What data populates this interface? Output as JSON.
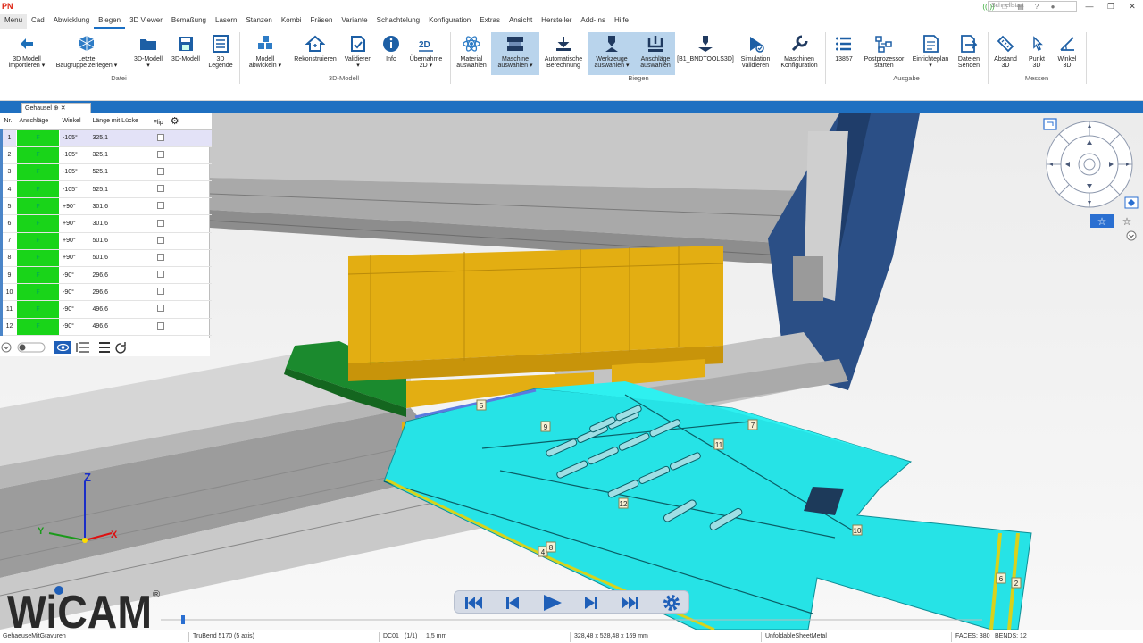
{
  "app": {
    "logo_text": "PN"
  },
  "tabs": [
    "Menu",
    "Cad",
    "Abwicklung",
    "Biegen",
    "3D Viewer",
    "Bemaßung",
    "Lasern",
    "Stanzen",
    "Kombi",
    "Fräsen",
    "Variante",
    "Schachtelung",
    "Konfiguration",
    "Extras",
    "Ansicht",
    "Hersteller",
    "Add-Ins",
    "Hilfe"
  ],
  "active_tab": "Biegen",
  "search": {
    "placeholder": "Schnellstart"
  },
  "ribbon": {
    "groups": {
      "datei": "Datei",
      "modell": "3D-Modell",
      "biegen": "Biegen",
      "ausgabe": "Ausgabe",
      "messen": "Messen"
    },
    "buttons": {
      "import3d": "3D Modell\nimportieren ▾",
      "letzte": "Letzte\nBaugruppe zerlegen ▾",
      "modell3d_a": "3D-Modell\n▾",
      "modell3d_b": "3D-Modell",
      "legende": "3D\nLegende",
      "abwickeln": "Modell\nabwickeln ▾",
      "rekon": "Rekonstruieren",
      "validieren": "Validieren\n▾",
      "info": "Info",
      "uebernahme": "Übernahme\n2D ▾",
      "material": "Material\nauswählen",
      "maschine": "Maschine\nauswählen ▾",
      "autoberech": "Automatische\nBerechnung",
      "werkzeuge": "Werkzeuge\nauswählen ▾",
      "anschlaege": "Anschläge\nauswählen",
      "tools": "[B1_BNDTOOLS3D]",
      "simulation": "Simulation\nvalidieren",
      "konfig": "Maschinen\nKonfiguration",
      "nr": "13857",
      "postproc": "Postprozessor\nstarten",
      "einricht": "Einrichteplan\n▾",
      "dateien": "Dateien\nSenden",
      "abstand": "Abstand\n3D",
      "punkt": "Punkt\n3D",
      "winkel": "Winkel\n3D"
    }
  },
  "document": {
    "tab_label": "Gehausel ⊕ ✕"
  },
  "bend_table": {
    "headers": [
      "Nr.",
      "Anschläge",
      "Winkel",
      "Länge mit Lücke",
      "Flip"
    ],
    "rows": [
      {
        "nr": "1",
        "stop": "F",
        "angle": "-105°",
        "length": "325,1"
      },
      {
        "nr": "2",
        "stop": "F",
        "angle": "-105°",
        "length": "325,1"
      },
      {
        "nr": "3",
        "stop": "F",
        "angle": "-105°",
        "length": "525,1"
      },
      {
        "nr": "4",
        "stop": "F",
        "angle": "-105°",
        "length": "525,1"
      },
      {
        "nr": "5",
        "stop": "F",
        "angle": "+90°",
        "length": "301,6"
      },
      {
        "nr": "6",
        "stop": "F",
        "angle": "+90°",
        "length": "301,6"
      },
      {
        "nr": "7",
        "stop": "F",
        "angle": "+90°",
        "length": "501,6"
      },
      {
        "nr": "8",
        "stop": "F",
        "angle": "+90°",
        "length": "501,6"
      },
      {
        "nr": "9",
        "stop": "F",
        "angle": "-90°",
        "length": "296,6"
      },
      {
        "nr": "10",
        "stop": "F",
        "angle": "-90°",
        "length": "296,6"
      },
      {
        "nr": "11",
        "stop": "F",
        "angle": "-90°",
        "length": "496,6"
      },
      {
        "nr": "12",
        "stop": "F",
        "angle": "-90°",
        "length": "496,6"
      }
    ],
    "selected_row": "1"
  },
  "scene": {
    "bend_labels": [
      "5",
      "9",
      "7",
      "11",
      "12",
      "10",
      "4",
      "8",
      "6",
      "2"
    ],
    "axes": {
      "x": "X",
      "y": "Y",
      "z": "Z"
    },
    "colors": {
      "sheet": "#26e3e6",
      "upper_tool": "#e3ae12",
      "die_holder": "#1b8a2e",
      "frame": "#2b4f86",
      "bendline": "#d8d21c"
    }
  },
  "logo": {
    "text": "WiCAM",
    "mark": "®"
  },
  "status": {
    "file": "GehaeuseMitGravuren",
    "machine": "TruBend 5170 (5 axis)",
    "dc": "DC01",
    "count": "(1/1)",
    "thickness": "1,5 mm",
    "dims": "328,48 x 528,48 x 169 mm",
    "type": "UnfoldableSheetMetal",
    "faces": "FACES: 380",
    "bends": "BENDS: 12"
  }
}
